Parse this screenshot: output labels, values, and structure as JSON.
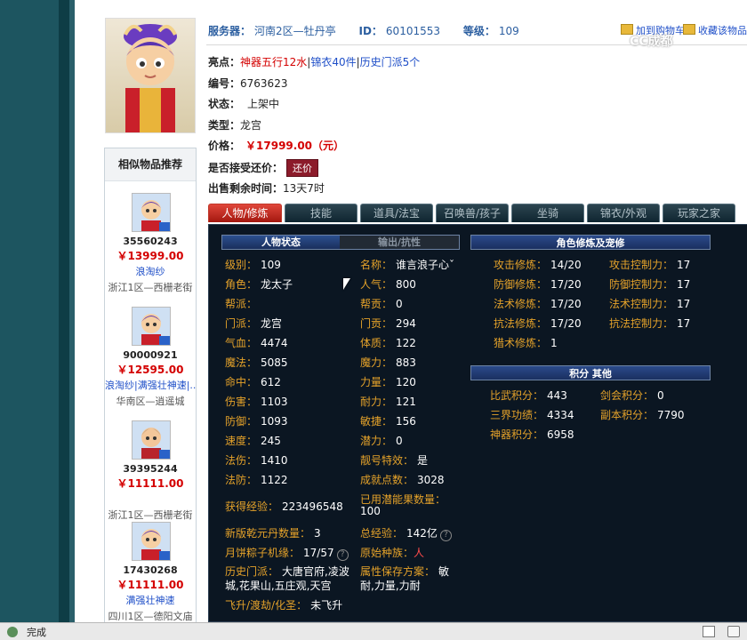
{
  "header": {
    "server_label": "服务器：",
    "server_value": "河南2区—牡丹亭",
    "id_label": "ID：",
    "id_value": "60101553",
    "level_label": "等级：",
    "level_value": "109",
    "link_1": "加到购物车",
    "link_2": "收藏该物品",
    "watermark": "CC成都"
  },
  "info": {
    "highlight_label": "亮点：",
    "highlight_1": "神器五行12水",
    "highlight_2": "锦衣40件",
    "highlight_3": "历史门派5个",
    "sep": "|",
    "code_label": "编号：",
    "code_value": "6763623",
    "status_label": "状态：",
    "status_value": "上架中",
    "type_label": "类型：",
    "type_value": "龙宫",
    "price_label": "价格：",
    "price_value": "￥17999.00（元）",
    "bargain_label": "是否接受还价：",
    "bargain_button": "还价",
    "remain_label": "出售剩余时间：",
    "remain_value": "13天7时"
  },
  "recommend": {
    "title": "相似物品推荐",
    "items": [
      {
        "id": "35560243",
        "price": "￥13999.00",
        "tag": "浪淘纱",
        "loc": "浙江1区—西栅老街"
      },
      {
        "id": "90000921",
        "price": "￥12595.00",
        "tag": "浪淘纱|满强壮神速|...",
        "loc": "华南区—逍遥城"
      },
      {
        "id": "39395244",
        "price": "￥11111.00",
        "tag": "",
        "loc": "浙江1区—西栅老街"
      },
      {
        "id": "17430268",
        "price": "￥11111.00",
        "tag": "满强壮神速",
        "loc": "四川1区—德阳文庙"
      }
    ]
  },
  "tabs": [
    "人物/修炼",
    "技能",
    "道具/法宝",
    "召唤兽/孩子",
    "坐骑",
    "锦衣/外观",
    "玩家之家"
  ],
  "panel": {
    "sub_tab_1": "人物状态",
    "sub_tab_2": "输出/抗性",
    "cultivation_head": "角色修炼及宠修",
    "score_head": "积分 其他",
    "left_stats": [
      {
        "k": "级别：",
        "v": "109"
      },
      {
        "k": "角色：",
        "v": "龙太子"
      },
      {
        "k": "帮派：",
        "v": ""
      },
      {
        "k": "门派：",
        "v": "龙宫"
      },
      {
        "k": "气血：",
        "v": "4474"
      },
      {
        "k": "魔法：",
        "v": "5085"
      },
      {
        "k": "命中：",
        "v": "612"
      },
      {
        "k": "伤害：",
        "v": "1103"
      },
      {
        "k": "防御：",
        "v": "1093"
      },
      {
        "k": "速度：",
        "v": "245"
      },
      {
        "k": "法伤：",
        "v": "1410"
      },
      {
        "k": "法防：",
        "v": "1122"
      }
    ],
    "right_stats": [
      {
        "k": "名称：",
        "v": "谁言浪子心ˇ"
      },
      {
        "k": "人气：",
        "v": "800"
      },
      {
        "k": "帮贡：",
        "v": "0"
      },
      {
        "k": "门贡：",
        "v": "294"
      },
      {
        "k": "体质：",
        "v": "122"
      },
      {
        "k": "魔力：",
        "v": "883"
      },
      {
        "k": "力量：",
        "v": "120"
      },
      {
        "k": "耐力：",
        "v": "121"
      },
      {
        "k": "敏捷：",
        "v": "156"
      },
      {
        "k": "潜力：",
        "v": "0"
      },
      {
        "k": "靓号特效：",
        "v": "是"
      },
      {
        "k": "成就点数：",
        "v": "3028"
      }
    ],
    "exp_label": "获得经验：",
    "exp_value": "223496548",
    "potential_label": "已用潜能果数量：",
    "potential_value": "100",
    "qianyuan_label": "新版乾元丹数量：",
    "qianyuan_value": "3",
    "total_exp_label": "总经验：",
    "total_exp_value": "142亿",
    "zongzi_label": "月饼粽子机缘：",
    "zongzi_value": "17/57",
    "race_label": "原始种族：",
    "race_value": "人",
    "history_label": "历史门派：",
    "history_value_1": "大唐官府,凌波",
    "history_value_2": "城,花果山,五庄观,天宫",
    "attr_label": "属性保存方案：",
    "attr_value_1": "敏",
    "attr_value_2": "耐,力量,力耐",
    "ascend_label": "飞升/渡劫/化圣：",
    "ascend_value": "未飞升",
    "cultivation": [
      {
        "k": "攻击修炼：",
        "v": "14/20",
        "k2": "攻击控制力：",
        "v2": "17"
      },
      {
        "k": "防御修炼：",
        "v": "17/20",
        "k2": "防御控制力：",
        "v2": "17"
      },
      {
        "k": "法术修炼：",
        "v": "17/20",
        "k2": "法术控制力：",
        "v2": "17"
      },
      {
        "k": "抗法修炼：",
        "v": "17/20",
        "k2": "抗法控制力：",
        "v2": "17"
      },
      {
        "k": "猎术修炼：",
        "v": "1",
        "k2": "",
        "v2": ""
      }
    ],
    "scores": [
      {
        "k": "比武积分：",
        "v": "443",
        "k2": "剑会积分：",
        "v2": "0"
      },
      {
        "k": "三界功绩：",
        "v": "4334",
        "k2": "副本积分：",
        "v2": "7790"
      },
      {
        "k": "神器积分：",
        "v": "6958",
        "k2": "",
        "v2": ""
      }
    ]
  },
  "statusbar": {
    "text": "完成"
  }
}
